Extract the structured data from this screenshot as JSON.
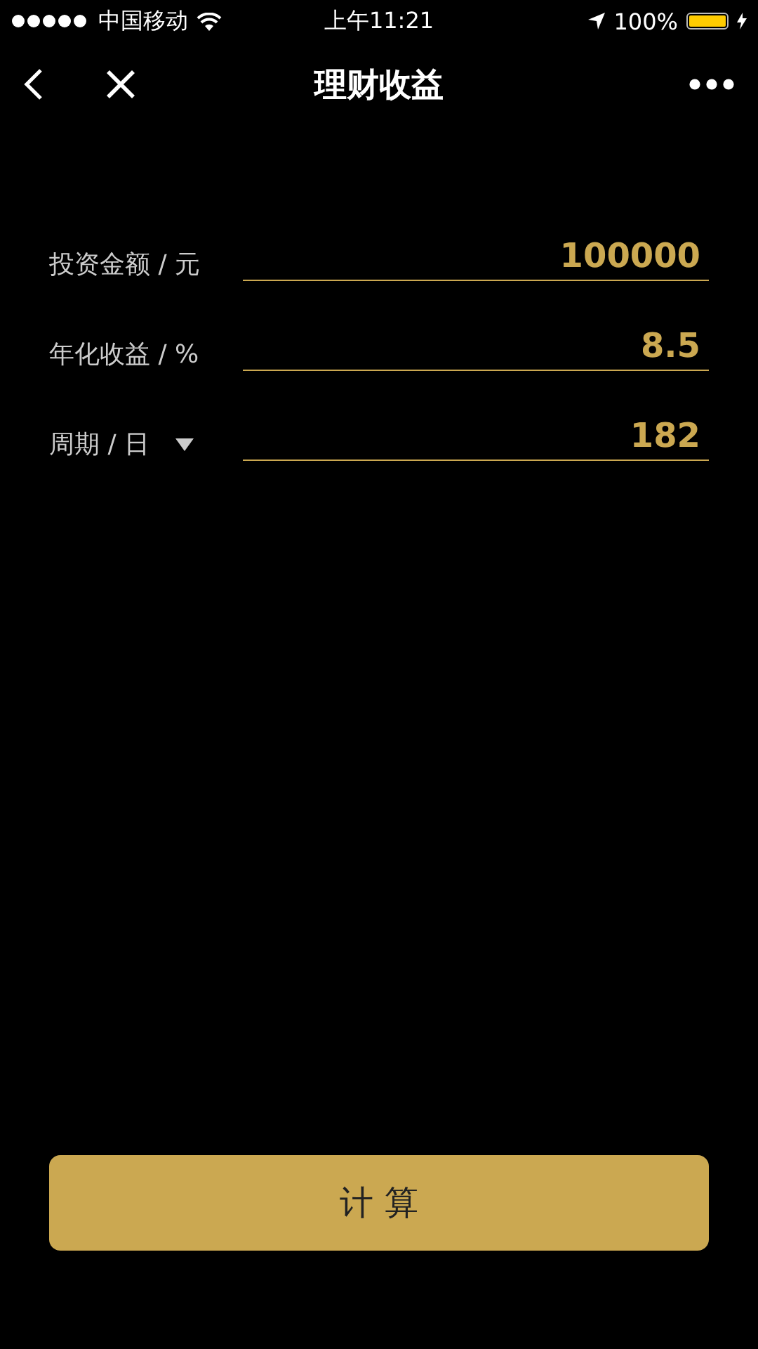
{
  "status_bar": {
    "carrier": "中国移动",
    "time": "上午11:21",
    "battery": "100%",
    "level": 1
  },
  "nav": {
    "title": "理财收益"
  },
  "fields": [
    {
      "kind": "text",
      "label": "投资金额 / 元",
      "value": "100000"
    },
    {
      "kind": "text",
      "label": "年化收益 / %",
      "value": "8.5"
    },
    {
      "kind": "select",
      "label": "周期 / 日",
      "value": "182"
    }
  ],
  "button": {
    "label": "计 算"
  }
}
